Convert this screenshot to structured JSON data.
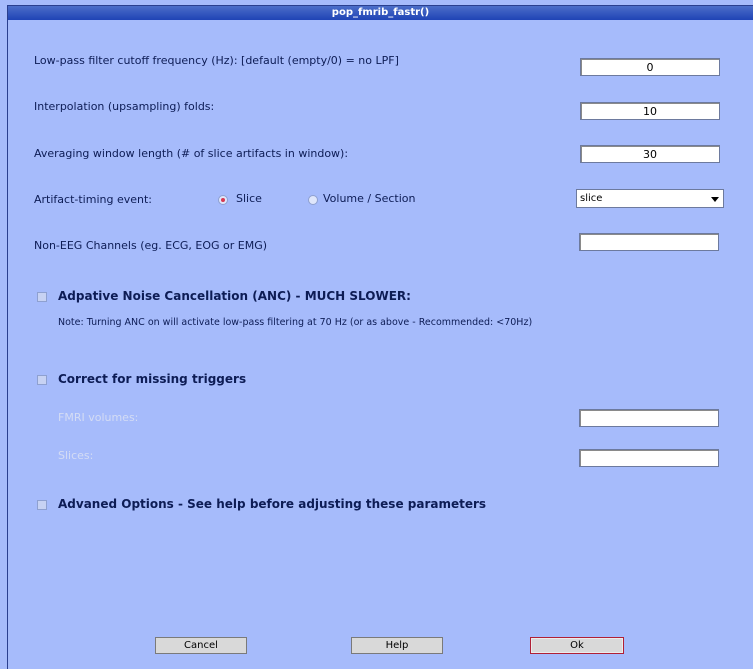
{
  "window": {
    "title": "pop_fmrib_fastr()"
  },
  "fields": {
    "lpf": {
      "label": "Low-pass filter cutoff frequency (Hz): [default (empty/0) = no LPF]",
      "value": "0"
    },
    "interp": {
      "label": "Interpolation (upsampling) folds:",
      "value": "10"
    },
    "avg": {
      "label": "Averaging window length (# of slice artifacts in window):",
      "value": "30"
    },
    "timing": {
      "label": "Artifact-timing event:",
      "radio_slice": "Slice",
      "radio_volume": "Volume / Section",
      "selected": "slice",
      "select_value": "slice"
    },
    "nonEEG": {
      "label": "Non-EEG Channels (eg. ECG, EOG or EMG)",
      "value": ""
    }
  },
  "anc": {
    "label": "Adpative Noise Cancellation (ANC) - MUCH SLOWER:",
    "note": "Note: Turning ANC on will activate low-pass filtering at 70 Hz (or as above - Recommended: <70Hz)",
    "checked": false
  },
  "missing": {
    "label": "Correct for missing triggers",
    "checked": false,
    "fmri_label": "FMRI volumes:",
    "fmri_value": "",
    "slices_label": "Slices:",
    "slices_value": ""
  },
  "advanced": {
    "label": "Advaned Options - See help before adjusting these parameters",
    "checked": false
  },
  "buttons": {
    "cancel": "Cancel",
    "help": "Help",
    "ok": "Ok"
  },
  "colors": {
    "background": "#a6bbfb",
    "titlebar": "#1f43b5",
    "text": "#0d1c55",
    "accent": "#d83a52"
  }
}
